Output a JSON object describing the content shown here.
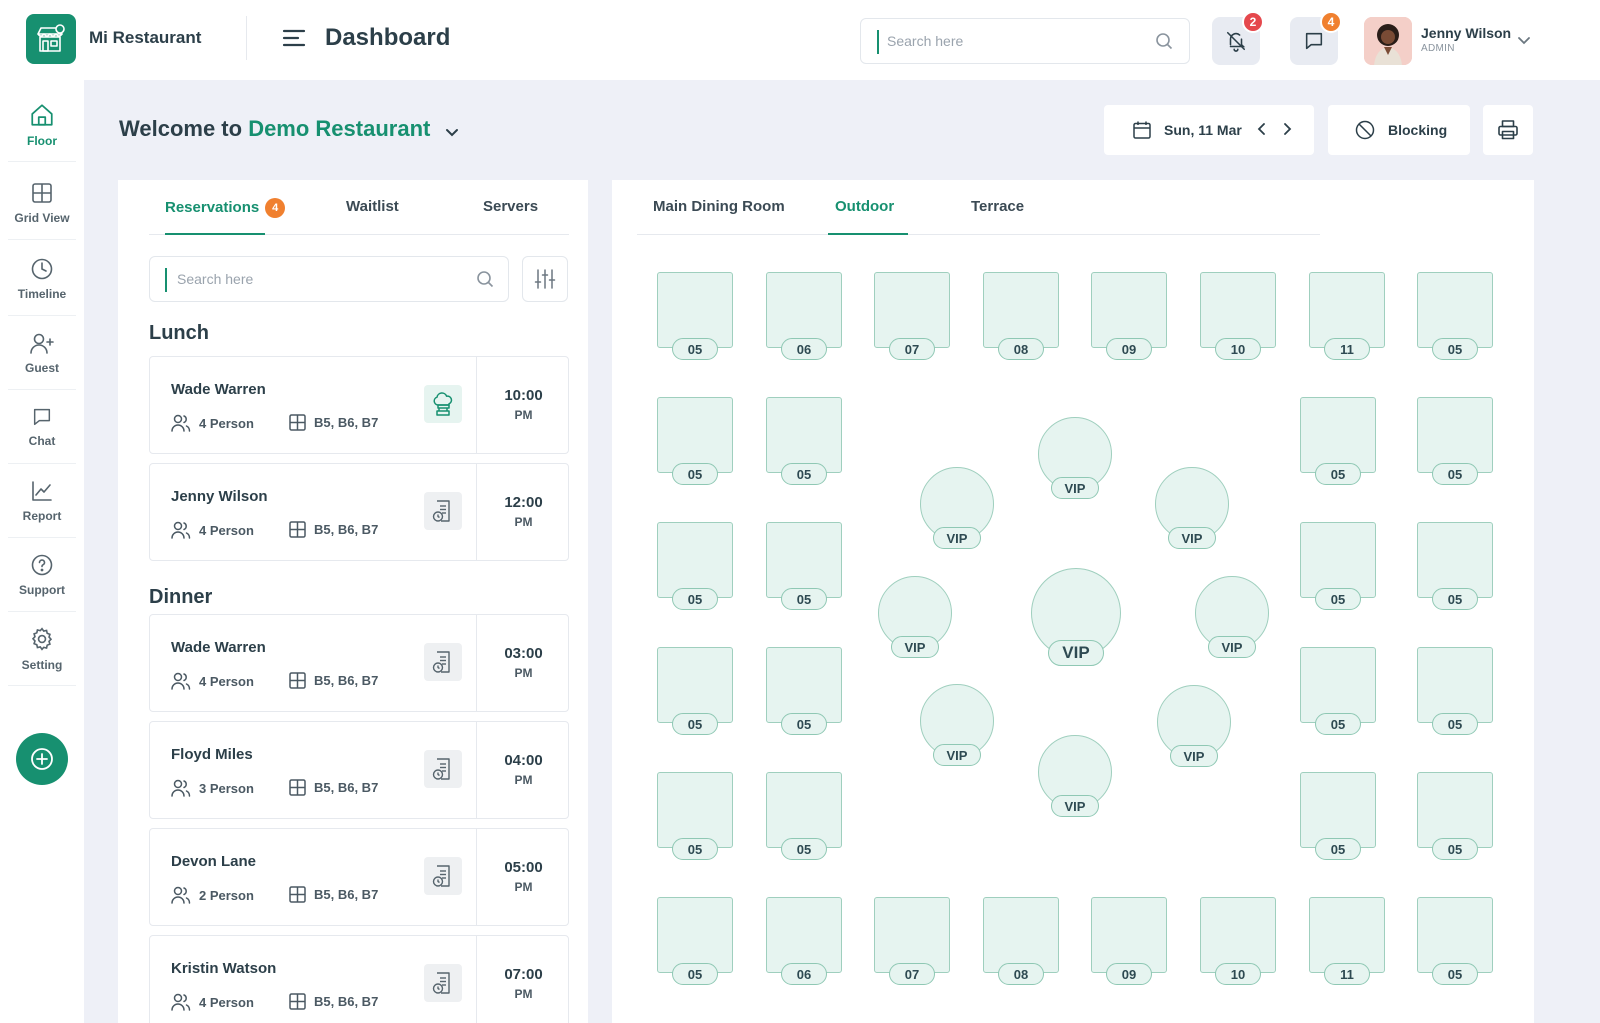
{
  "header": {
    "brand": "Mi Restaurant",
    "title": "Dashboard",
    "search_placeholder": "Search here",
    "notifications_count": "2",
    "messages_count": "4",
    "user_name": "Jenny Wilson",
    "user_role": "ADMIN"
  },
  "sidebar": {
    "items": [
      {
        "label": "Floor",
        "icon": "home-icon"
      },
      {
        "label": "Grid View",
        "icon": "grid-icon"
      },
      {
        "label": "Timeline",
        "icon": "clock-icon"
      },
      {
        "label": "Guest",
        "icon": "user-plus-icon"
      },
      {
        "label": "Chat",
        "icon": "chat-icon"
      },
      {
        "label": "Report",
        "icon": "chart-icon"
      },
      {
        "label": "Support",
        "icon": "help-icon"
      },
      {
        "label": "Setting",
        "icon": "gear-icon"
      }
    ]
  },
  "welcome": {
    "prefix": "Welcome to",
    "restaurant": "Demo Restaurant",
    "date": "Sun, 11 Mar",
    "blocking_label": "Blocking"
  },
  "reservations": {
    "tabs": [
      "Reservations",
      "Waitlist",
      "Servers"
    ],
    "tab_count": "4",
    "search_placeholder": "Search here",
    "sections": [
      {
        "title": "Lunch",
        "items": [
          {
            "name": "Wade Warren",
            "guests": "4 Person",
            "tables": "B5, B6, B7",
            "time": "10:00",
            "ampm": "PM",
            "icon": "chef-icon"
          },
          {
            "name": "Jenny Wilson",
            "guests": "4 Person",
            "tables": "B5, B6, B7",
            "time": "12:00",
            "ampm": "PM",
            "icon": "order-clock-icon"
          }
        ]
      },
      {
        "title": "Dinner",
        "items": [
          {
            "name": "Wade Warren",
            "guests": "4 Person",
            "tables": "B5, B6, B7",
            "time": "03:00",
            "ampm": "PM",
            "icon": "order-clock-icon"
          },
          {
            "name": "Floyd Miles",
            "guests": "3 Person",
            "tables": "B5, B6, B7",
            "time": "04:00",
            "ampm": "PM",
            "icon": "order-clock-icon"
          },
          {
            "name": "Devon Lane",
            "guests": "2 Person",
            "tables": "B5, B6, B7",
            "time": "05:00",
            "ampm": "PM",
            "icon": "order-clock-icon"
          },
          {
            "name": "Kristin Watson",
            "guests": "4 Person",
            "tables": "B5, B6, B7",
            "time": "07:00",
            "ampm": "PM",
            "icon": "order-clock-icon"
          }
        ]
      }
    ]
  },
  "floor": {
    "tabs": [
      "Main Dining Room",
      "Outdoor",
      "Terrace"
    ],
    "active_tab": "Outdoor",
    "top_row": [
      "05",
      "06",
      "07",
      "08",
      "09",
      "10",
      "11",
      "05"
    ],
    "left_columns": [
      [
        "05",
        "05"
      ],
      [
        "05",
        "05"
      ],
      [
        "05",
        "05"
      ],
      [
        "05",
        "05"
      ]
    ],
    "right_columns": [
      [
        "05",
        "05"
      ],
      [
        "05",
        "05"
      ],
      [
        "05",
        "05"
      ],
      [
        "05",
        "05"
      ]
    ],
    "vip_tables": [
      "VIP",
      "VIP",
      "VIP",
      "VIP",
      "VIP",
      "VIP",
      "VIP",
      "VIP",
      "VIP"
    ],
    "bottom_row": [
      "05",
      "06",
      "07",
      "08",
      "09",
      "10",
      "11",
      "05"
    ]
  },
  "colors": {
    "accent": "#179070",
    "badge_red": "#e5484d",
    "badge_orange": "#f0802f",
    "table_fill": "#e6f4f0",
    "table_border": "#9fcfbe"
  }
}
